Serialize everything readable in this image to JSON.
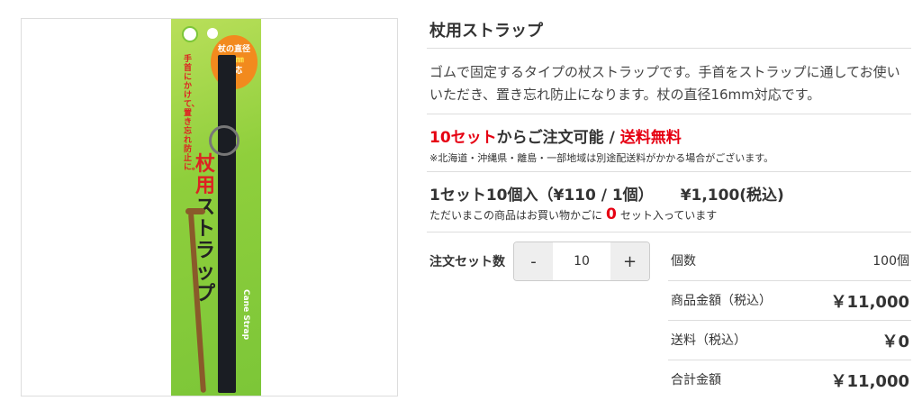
{
  "product": {
    "title": "杖用ストラップ",
    "description": "ゴムで固定するタイプの杖ストラップです。手首をストラップに通してお使いいただき、置き忘れ防止になります。杖の直径16mm対応です。",
    "image": {
      "badge_line1": "杖の直径",
      "badge_line2": "16㎜",
      "badge_line3": "対応",
      "side_text": "手首にかけて、置き忘れ防止に。",
      "title_red": "杖用",
      "title_black": "ストラップ",
      "sub": "Cane Strap"
    }
  },
  "order": {
    "min_sets": "10セット",
    "min_suffix": "からご注文可能 / ",
    "free_shipping": "送料無料",
    "note": "※北海道・沖縄県・離島・一部地域は別途配送料がかかる場合がございます。"
  },
  "price": {
    "set_info": "1セット10個入（¥110 / 1個）",
    "total": "¥1,100(税込)",
    "cart_prefix": "ただいまこの商品はお買い物かごに",
    "cart_count": "0",
    "cart_suffix": "セット入っています"
  },
  "quantity": {
    "label": "注文セット数",
    "minus": "-",
    "value": "10",
    "plus": "+"
  },
  "summary": {
    "rows": [
      {
        "label": "個数",
        "value": "100個"
      },
      {
        "label": "商品金額（税込）",
        "value": "￥11,000"
      },
      {
        "label": "送料（税込）",
        "value": "￥0"
      },
      {
        "label": "合計金額",
        "value": "￥11,000"
      }
    ]
  },
  "colors": {
    "accent_red": "#e60012",
    "package_green": "#8fcf3c"
  }
}
